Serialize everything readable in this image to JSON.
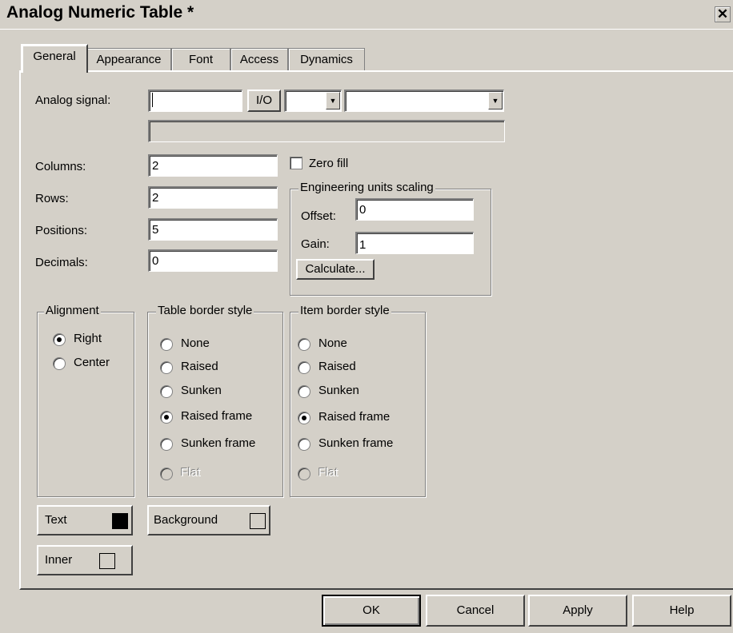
{
  "window": {
    "title": "Analog Numeric Table *",
    "close_symbol": "✕"
  },
  "tabs": [
    {
      "label": "General",
      "active": true
    },
    {
      "label": "Appearance",
      "active": false
    },
    {
      "label": "Font",
      "active": false
    },
    {
      "label": "Access",
      "active": false
    },
    {
      "label": "Dynamics",
      "active": false
    }
  ],
  "analog_signal": {
    "label": "Analog signal:",
    "value": "",
    "io_button": "I/O",
    "dropdown1_value": "",
    "dropdown2_value": "",
    "expression_value": ""
  },
  "fields": {
    "columns": {
      "label": "Columns:",
      "value": "2"
    },
    "rows": {
      "label": "Rows:",
      "value": "2"
    },
    "positions": {
      "label": "Positions:",
      "value": "5"
    },
    "decimals": {
      "label": "Decimals:",
      "value": "0"
    }
  },
  "zero_fill": {
    "label": "Zero fill",
    "checked": false
  },
  "scaling": {
    "title": "Engineering units scaling",
    "offset_label": "Offset:",
    "offset_value": "0",
    "gain_label": "Gain:",
    "gain_value": "1",
    "calculate_button": "Calculate..."
  },
  "alignment": {
    "title": "Alignment",
    "options": [
      {
        "label": "Right",
        "checked": true
      },
      {
        "label": "Center",
        "checked": false
      }
    ]
  },
  "table_border": {
    "title": "Table border style",
    "options": [
      {
        "label": "None",
        "checked": false
      },
      {
        "label": "Raised",
        "checked": false
      },
      {
        "label": "Sunken",
        "checked": false
      },
      {
        "label": "Raised frame",
        "checked": true
      },
      {
        "label": "Sunken frame",
        "checked": false
      },
      {
        "label": "Flat",
        "checked": false,
        "disabled": true
      }
    ]
  },
  "item_border": {
    "title": "Item border style",
    "options": [
      {
        "label": "None",
        "checked": false
      },
      {
        "label": "Raised",
        "checked": false
      },
      {
        "label": "Sunken",
        "checked": false
      },
      {
        "label": "Raised frame",
        "checked": true
      },
      {
        "label": "Sunken frame",
        "checked": false
      },
      {
        "label": "Flat",
        "checked": false,
        "disabled": true
      }
    ]
  },
  "color_buttons": {
    "text": {
      "label": "Text",
      "color": "#000000"
    },
    "background": {
      "label": "Background",
      "color": "#d4d0c8"
    },
    "inner": {
      "label": "Inner",
      "color": "#d4d0c8"
    }
  },
  "footer": {
    "ok": "OK",
    "cancel": "Cancel",
    "apply": "Apply",
    "help": "Help"
  },
  "colors": {
    "face": "#d4d0c8",
    "highlight": "#ffffff",
    "shadow": "#808080",
    "dark_shadow": "#404040"
  }
}
